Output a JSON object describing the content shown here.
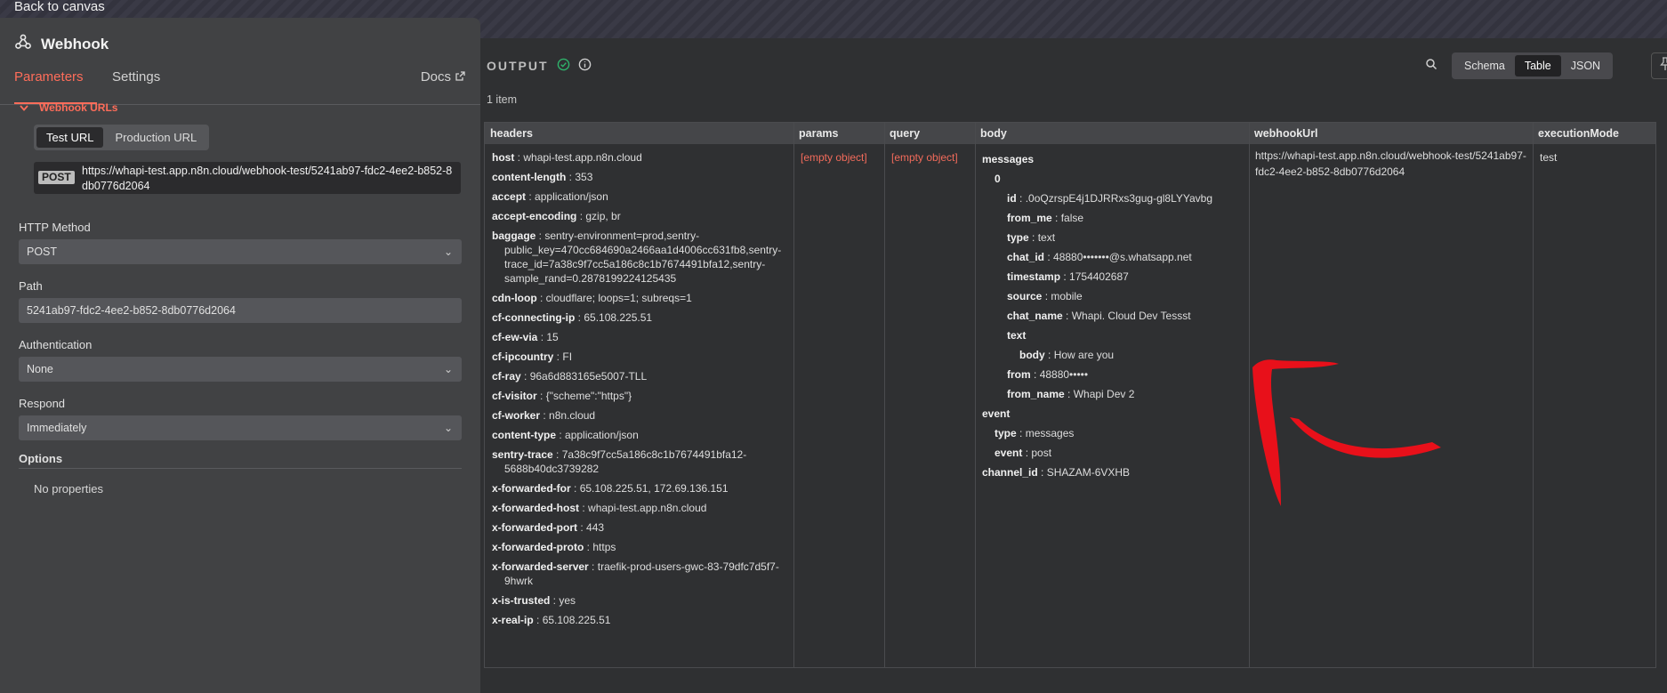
{
  "nav": {
    "back_label": "Back to canvas"
  },
  "node": {
    "title": "Webhook",
    "tabs": [
      "Parameters",
      "Settings"
    ],
    "docs_label": "Docs",
    "webhook_urls": {
      "heading": "Webhook URLs",
      "toggle": [
        "Test URL",
        "Production URL"
      ],
      "method_badge": "POST",
      "url": "https://whapi-test.app.n8n.cloud/webhook-test/5241ab97-fdc2-4ee2-b852-8db0776d2064"
    },
    "fields": {
      "http_method": {
        "label": "HTTP Method",
        "value": "POST"
      },
      "path": {
        "label": "Path",
        "value": "5241ab97-fdc2-4ee2-b852-8db0776d2064"
      },
      "authentication": {
        "label": "Authentication",
        "value": "None"
      },
      "respond": {
        "label": "Respond",
        "value": "Immediately"
      }
    },
    "options": {
      "label": "Options",
      "empty": "No properties"
    }
  },
  "output": {
    "title": "OUTPUT",
    "item_count": "1 item",
    "views": [
      "Schema",
      "Table",
      "JSON"
    ],
    "active_view": "Table",
    "columns": [
      "headers",
      "params",
      "query",
      "body",
      "webhookUrl",
      "executionMode"
    ],
    "headers": [
      {
        "k": "host",
        "v": "whapi-test.app.n8n.cloud"
      },
      {
        "k": "content-length",
        "v": "353"
      },
      {
        "k": "accept",
        "v": "application/json"
      },
      {
        "k": "accept-encoding",
        "v": "gzip, br"
      },
      {
        "k": "baggage",
        "v": "sentry-environment=prod,sentry-public_key=470cc684690a2466aa1d4006cc631fb8,sentry-trace_id=7a38c9f7cc5a186c8c1b7674491bfa12,sentry-sample_rand=0.2878199224125435"
      },
      {
        "k": "cdn-loop",
        "v": "cloudflare; loops=1; subreqs=1"
      },
      {
        "k": "cf-connecting-ip",
        "v": "65.108.225.51"
      },
      {
        "k": "cf-ew-via",
        "v": "15"
      },
      {
        "k": "cf-ipcountry",
        "v": "FI"
      },
      {
        "k": "cf-ray",
        "v": "96a6d883165e5007-TLL"
      },
      {
        "k": "cf-visitor",
        "v": "{\"scheme\":\"https\"}"
      },
      {
        "k": "cf-worker",
        "v": "n8n.cloud"
      },
      {
        "k": "content-type",
        "v": "application/json"
      },
      {
        "k": "sentry-trace",
        "v": "7a38c9f7cc5a186c8c1b7674491bfa12-5688b40dc3739282"
      },
      {
        "k": "x-forwarded-for",
        "v": "65.108.225.51, 172.69.136.151"
      },
      {
        "k": "x-forwarded-host",
        "v": "whapi-test.app.n8n.cloud"
      },
      {
        "k": "x-forwarded-port",
        "v": "443"
      },
      {
        "k": "x-forwarded-proto",
        "v": "https"
      },
      {
        "k": "x-forwarded-server",
        "v": "traefik-prod-users-gwc-83-79dfc7d5f7-9hwrk"
      },
      {
        "k": "x-is-trusted",
        "v": "yes"
      },
      {
        "k": "x-real-ip",
        "v": "65.108.225.51"
      }
    ],
    "params": "[empty object]",
    "query": "[empty object]",
    "body": [
      {
        "k": "messages",
        "v": ""
      },
      {
        "k": "0",
        "v": ""
      },
      {
        "k": "id",
        "v": ".0oQzrspE4j1DJRRxs3gug-gl8LYYavbg"
      },
      {
        "k": "from_me",
        "v": "false"
      },
      {
        "k": "type",
        "v": "text"
      },
      {
        "k": "chat_id",
        "v": "48880•••••••@s.whatsapp.net"
      },
      {
        "k": "timestamp",
        "v": "1754402687"
      },
      {
        "k": "source",
        "v": "mobile"
      },
      {
        "k": "chat_name",
        "v": "Whapi. Cloud Dev Tessst"
      },
      {
        "k": "text",
        "v": ""
      },
      {
        "k": "body",
        "v": "How are you"
      },
      {
        "k": "from",
        "v": "48880•••••"
      },
      {
        "k": "from_name",
        "v": "Whapi Dev 2"
      },
      {
        "k": "event",
        "v": ""
      },
      {
        "k": "type",
        "v": "messages"
      },
      {
        "k": "event",
        "v": "post"
      },
      {
        "k": "channel_id",
        "v": "SHAZAM-6VXHB"
      }
    ],
    "webhookUrl": "https://whapi-test.app.n8n.cloud/webhook-test/5241ab97-fdc2-4ee2-b852-8db0776d2064",
    "executionMode": "test"
  },
  "colors": {
    "accent": "#ff6d5a",
    "success": "#2fb36b",
    "annotation": "#e8101a"
  }
}
